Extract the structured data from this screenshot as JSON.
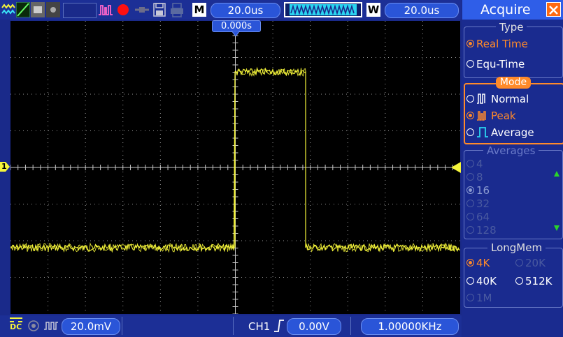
{
  "toolbar": {
    "m_label": "M",
    "timebase": "20.0us",
    "w_label": "W",
    "window_timebase": "20.0us",
    "trigger_pos": "0.000s"
  },
  "bottom": {
    "coupling": "DC",
    "volts_div": "20.0mV",
    "trig_source": "CH1",
    "trig_level": "0.00V",
    "frequency": "1.00000KHz"
  },
  "markers": {
    "ch1_label": "1"
  },
  "menu": {
    "title": "Acquire",
    "type": {
      "header": "Type",
      "options": [
        "Real Time",
        "Equ-Time"
      ],
      "selected": 0
    },
    "mode": {
      "header": "Mode",
      "options": [
        "Normal",
        "Peak",
        "Average"
      ],
      "selected": 1
    },
    "averages": {
      "header": "Averages",
      "options": [
        "4",
        "8",
        "16",
        "32",
        "64",
        "128"
      ],
      "selected": 2
    },
    "longmem": {
      "header": "LongMem",
      "options": [
        "4K",
        "20K",
        "40K",
        "512K",
        "1M"
      ],
      "selected": 0
    }
  },
  "colors": {
    "trace": "#f5f53a",
    "accent": "#2f5ee8",
    "highlight": "#ff8a2a"
  }
}
